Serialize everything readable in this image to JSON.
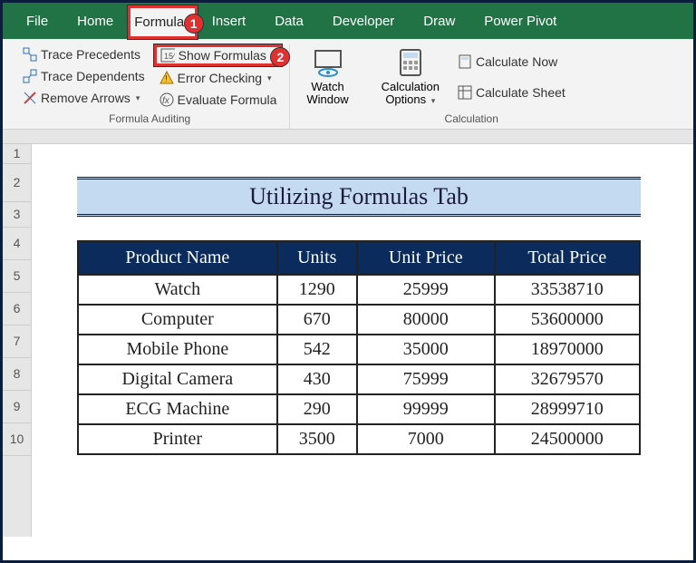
{
  "tabs": {
    "file": "File",
    "home": "Home",
    "formulas": "Formulas",
    "insert": "Insert",
    "data": "Data",
    "developer": "Developer",
    "draw": "Draw",
    "powerpivot": "Power Pivot"
  },
  "callouts": {
    "c1": "1",
    "c2": "2"
  },
  "ribbon": {
    "trace_precedents": "Trace Precedents",
    "trace_dependents": "Trace Dependents",
    "remove_arrows": "Remove Arrows",
    "show_formulas": "Show Formulas",
    "error_checking": "Error Checking",
    "evaluate_formula": "Evaluate Formula",
    "watch_window": "Watch\nWindow",
    "calc_options": "Calculation\nOptions",
    "calc_now": "Calculate Now",
    "calc_sheet": "Calculate Sheet",
    "group_auditing": "Formula Auditing",
    "group_calc": "Calculation"
  },
  "rows": [
    "1",
    "2",
    "3",
    "4",
    "5",
    "6",
    "7",
    "8",
    "9",
    "10"
  ],
  "title": "Utilizing Formulas Tab",
  "table": {
    "headers": [
      "Product Name",
      "Units",
      "Unit Price",
      "Total Price"
    ],
    "rows": [
      [
        "Watch",
        "1290",
        "25999",
        "33538710"
      ],
      [
        "Computer",
        "670",
        "80000",
        "53600000"
      ],
      [
        "Mobile Phone",
        "542",
        "35000",
        "18970000"
      ],
      [
        "Digital Camera",
        "430",
        "75999",
        "32679570"
      ],
      [
        "ECG Machine",
        "290",
        "99999",
        "28999710"
      ],
      [
        "Printer",
        "3500",
        "7000",
        "24500000"
      ]
    ]
  }
}
